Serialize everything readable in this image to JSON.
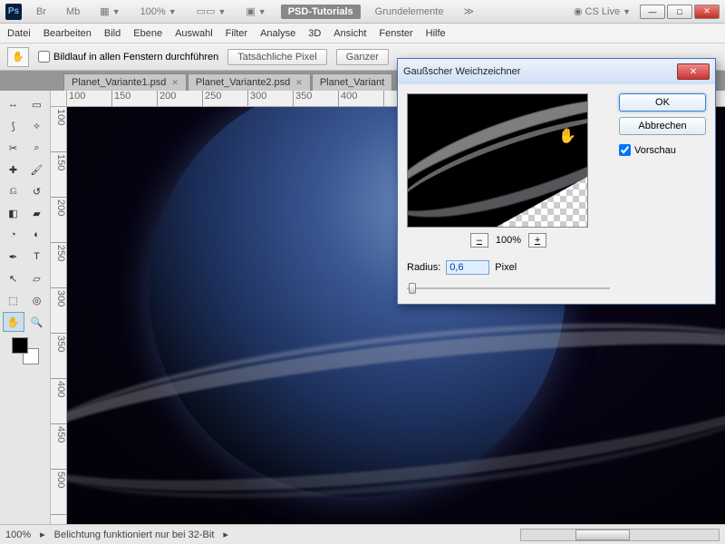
{
  "topbar": {
    "ps": "Ps",
    "br": "Br",
    "mb": "Mb",
    "zoom": "100%",
    "workspace1": "PSD-Tutorials",
    "workspace2": "Grundelemente",
    "cslive": "CS Live"
  },
  "menu": {
    "datei": "Datei",
    "bearbeiten": "Bearbeiten",
    "bild": "Bild",
    "ebene": "Ebene",
    "auswahl": "Auswahl",
    "filter": "Filter",
    "analyse": "Analyse",
    "dreid": "3D",
    "ansicht": "Ansicht",
    "fenster": "Fenster",
    "hilfe": "Hilfe"
  },
  "options": {
    "scroll_all": "Bildlauf in allen Fenstern durchführen",
    "actual_pixels": "Tatsächliche Pixel",
    "fit_screen": "Ganzer"
  },
  "tabs": [
    {
      "label": "Planet_Variante1.psd"
    },
    {
      "label": "Planet_Variante2.psd"
    },
    {
      "label": "Planet_Variant"
    }
  ],
  "ruler_h": [
    "100",
    "150",
    "200",
    "250",
    "300",
    "350",
    "400"
  ],
  "ruler_v": [
    "100",
    "150",
    "200",
    "250",
    "300",
    "350",
    "400",
    "450",
    "500"
  ],
  "status": {
    "zoom": "100%",
    "msg": "Belichtung funktioniert nur bei 32-Bit"
  },
  "dialog": {
    "title": "Gaußscher Weichzeichner",
    "ok": "OK",
    "cancel": "Abbrechen",
    "preview_chk": "Vorschau",
    "zoom_label": "100%",
    "radius_label": "Radius:",
    "radius_value": "0,6",
    "radius_unit": "Pixel",
    "minus": "–",
    "plus": "+"
  }
}
